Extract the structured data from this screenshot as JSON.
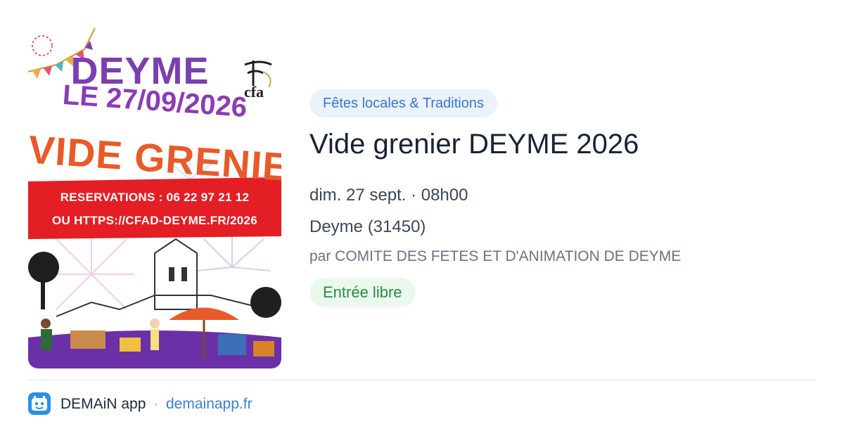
{
  "poster": {
    "town": "DEYME",
    "date": "LE 27/09/2026",
    "title": "VIDE GRENIER",
    "reservations": "RESERVATIONS : 06 22 97 21 12",
    "url": "OU HTTPS://CFAD-DEYME.FR/2026",
    "logo": "cfa"
  },
  "event": {
    "category": "Fêtes locales & Traditions",
    "title": "Vide grenier DEYME 2026",
    "datetime": "dim. 27 sept. · 08h00",
    "location": "Deyme (31450)",
    "organizer": "par COMITE DES FETES ET D'ANIMATION DE DEYME",
    "price": "Entrée libre"
  },
  "footer": {
    "icon": "demain-app-icon",
    "app_name": "DEMAiN app",
    "separator": "·",
    "link": "demainapp.fr"
  },
  "colors": {
    "badge_bg": "#eaf2fc",
    "badge_text": "#3b78c8",
    "price_bg": "#ebf8ee",
    "price_text": "#2a8a44",
    "link": "#3b7fd4"
  }
}
